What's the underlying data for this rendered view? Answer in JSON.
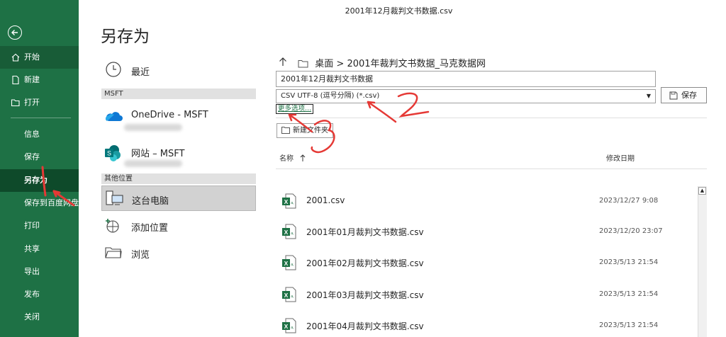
{
  "window": {
    "title": "2001年12月裁判文书数据.csv"
  },
  "sidebar": {
    "items": [
      {
        "label": "开始"
      },
      {
        "label": "新建"
      },
      {
        "label": "打开"
      },
      {
        "label": "信息"
      },
      {
        "label": "保存"
      },
      {
        "label": "另存为"
      },
      {
        "label": "保存到百度网盘"
      },
      {
        "label": "打印"
      },
      {
        "label": "共享"
      },
      {
        "label": "导出"
      },
      {
        "label": "发布"
      },
      {
        "label": "关闭"
      }
    ]
  },
  "page": {
    "title": "另存为"
  },
  "locations": {
    "recent": "最近",
    "group_msft": "MSFT",
    "onedrive": "OneDrive - MSFT",
    "sites": "网站 – MSFT",
    "group_other": "其他位置",
    "this_pc": "这台电脑",
    "add_place": "添加位置",
    "browse": "浏览"
  },
  "pane": {
    "breadcrumb": "桌面 > 2001年裁判文书数据_马克数据网",
    "filename": "2001年12月裁判文书数据",
    "filetype": "CSV UTF-8 (逗号分隔) (*.csv)",
    "save_label": "保存",
    "more_options": "更多选项...",
    "new_folder": "新建文件夹",
    "col_name": "名称",
    "col_modified": "修改日期"
  },
  "files": [
    {
      "name": "2001.csv",
      "date": "2023/12/27 9:08"
    },
    {
      "name": "2001年01月裁判文书数据.csv",
      "date": "2023/12/20 23:07"
    },
    {
      "name": "2001年02月裁判文书数据.csv",
      "date": "2023/5/13 21:54"
    },
    {
      "name": "2001年03月裁判文书数据.csv",
      "date": "2023/5/13 21:54"
    },
    {
      "name": "2001年04月裁判文书数据.csv",
      "date": "2023/5/13 21:54"
    }
  ],
  "annotations": {
    "mark1": "1",
    "mark2": "2",
    "mark3": "3"
  },
  "colors": {
    "sidebar": "#1e7145",
    "sidebar_selected": "#0e4a2a",
    "annotation": "#e53935",
    "excel_green": "#1e7145"
  }
}
